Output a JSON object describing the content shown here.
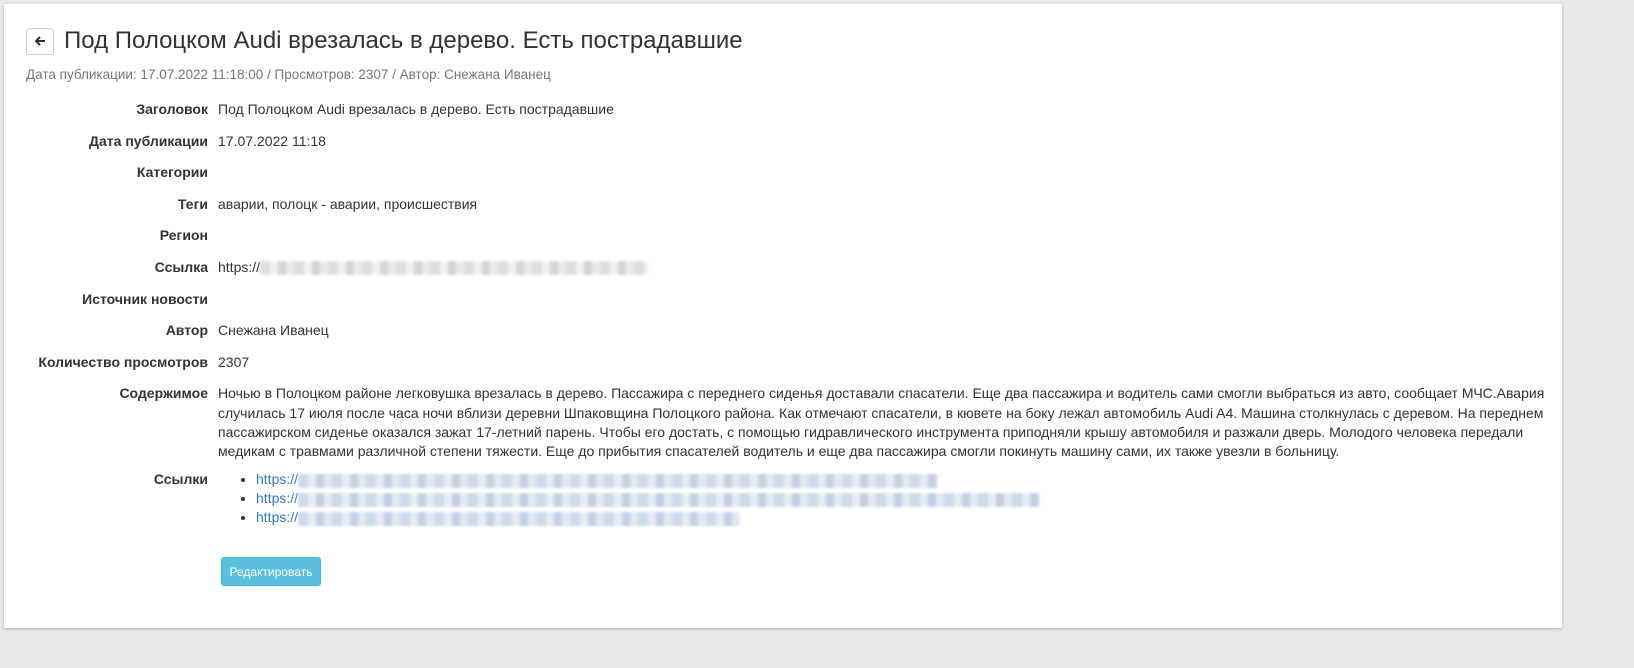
{
  "header": {
    "back_icon": "arrow-left-icon",
    "title": "Под Полоцком Audi врезалась в дерево. Есть пострадавшие",
    "meta": "Дата публикации: 17.07.2022 11:18:00 / Просмотров: 2307 / Автор: Снежана Иванец"
  },
  "fields": {
    "title": {
      "label": "Заголовок",
      "value": "Под Полоцком Audi врезалась в дерево. Есть пострадавшие"
    },
    "pub_date": {
      "label": "Дата публикации",
      "value": "17.07.2022 11:18"
    },
    "categories": {
      "label": "Категории",
      "value": ""
    },
    "tags": {
      "label": "Теги",
      "value": "аварии, полоцк - аварии, происшествия"
    },
    "region": {
      "label": "Регион",
      "value": ""
    },
    "link": {
      "label": "Ссылка",
      "value": "https://"
    },
    "source": {
      "label": "Источник новости",
      "value": ""
    },
    "author": {
      "label": "Автор",
      "value": "Снежана Иванец"
    },
    "views": {
      "label": "Количество просмотров",
      "value": "2307"
    },
    "content": {
      "label": "Содержимое",
      "value": "Ночью в Полоцком районе легковушка врезалась в дерево. Пассажира с переднего сиденья доставали спасатели. Еще два пассажира и водитель сами смогли выбраться из авто, сообщает МЧС.Авария случилась 17 июля после часа ночи вблизи деревни Шпаковщина Полоцкого района. Как отмечают спасатели, в кювете на боку лежал автомобиль Audi A4. Машина столкнулась с деревом. На переднем пассажирском сиденье оказался зажат 17-летний парень. Чтобы его достать, с помощью гидравлического инструмента приподняли крышу автомобиля и разжали дверь. Молодого человека передали медикам с травмами различной степени тяжести. Еще до прибытия спасателей водитель и еще два пассажира смогли покинуть машину сами, их также увезли в больницу."
    },
    "links": {
      "label": "Ссылки",
      "items": [
        "https://",
        "https://",
        "https://"
      ]
    }
  },
  "actions": {
    "edit_label": "Редактировать"
  },
  "colors": {
    "accent": "#5bc0de",
    "link": "#337ab7",
    "muted": "#777777"
  }
}
